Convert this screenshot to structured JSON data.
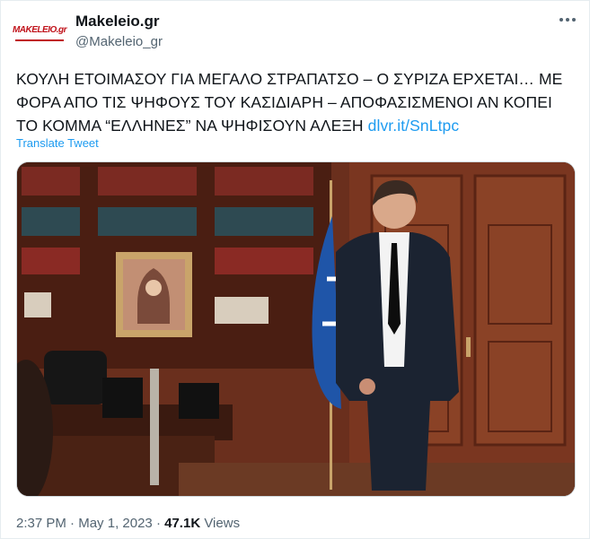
{
  "account": {
    "avatar_text": "MAKELEIO.gr",
    "display_name": "Makeleio.gr",
    "handle": "@Makeleio_gr"
  },
  "menu": {
    "icon": "more-dots-icon"
  },
  "tweet": {
    "text": "ΚΟΥΛΗ ΕΤΟΙΜΑΣΟΥ ΓΙΑ ΜΕΓΑΛΟ ΣΤΡΑΠΑΤΣΟ – Ο ΣΥΡΙΖΑ ΕΡΧΕΤΑΙ… ΜΕ ΦΟΡΑ ΑΠΟ ΤΙΣ ΨΗΦΟΥΣ ΤΟΥ ΚΑΣΙΔΙΑΡΗ – ΑΠΟΦΑΣΙΣΜΕΝΟΙ ΑΝ ΚΟΠΕΙ ΤΟ ΚΟΜΜΑ “ΕΛΛΗΝΕΣ” ΝΑ ΨΗΦΙΣΟΥΝ ΑΛΕΞΗ",
    "link": "dlvr.it/SnLtpc",
    "translate_label": "Translate Tweet"
  },
  "meta": {
    "time": "2:37 PM",
    "separator1": " · ",
    "date": "May 1, 2023",
    "separator2": " · ",
    "views_count": "47.1K",
    "views_label": " Views"
  },
  "colors": {
    "link": "#1d9bf0",
    "secondary": "#536471",
    "text": "#0f1419"
  }
}
